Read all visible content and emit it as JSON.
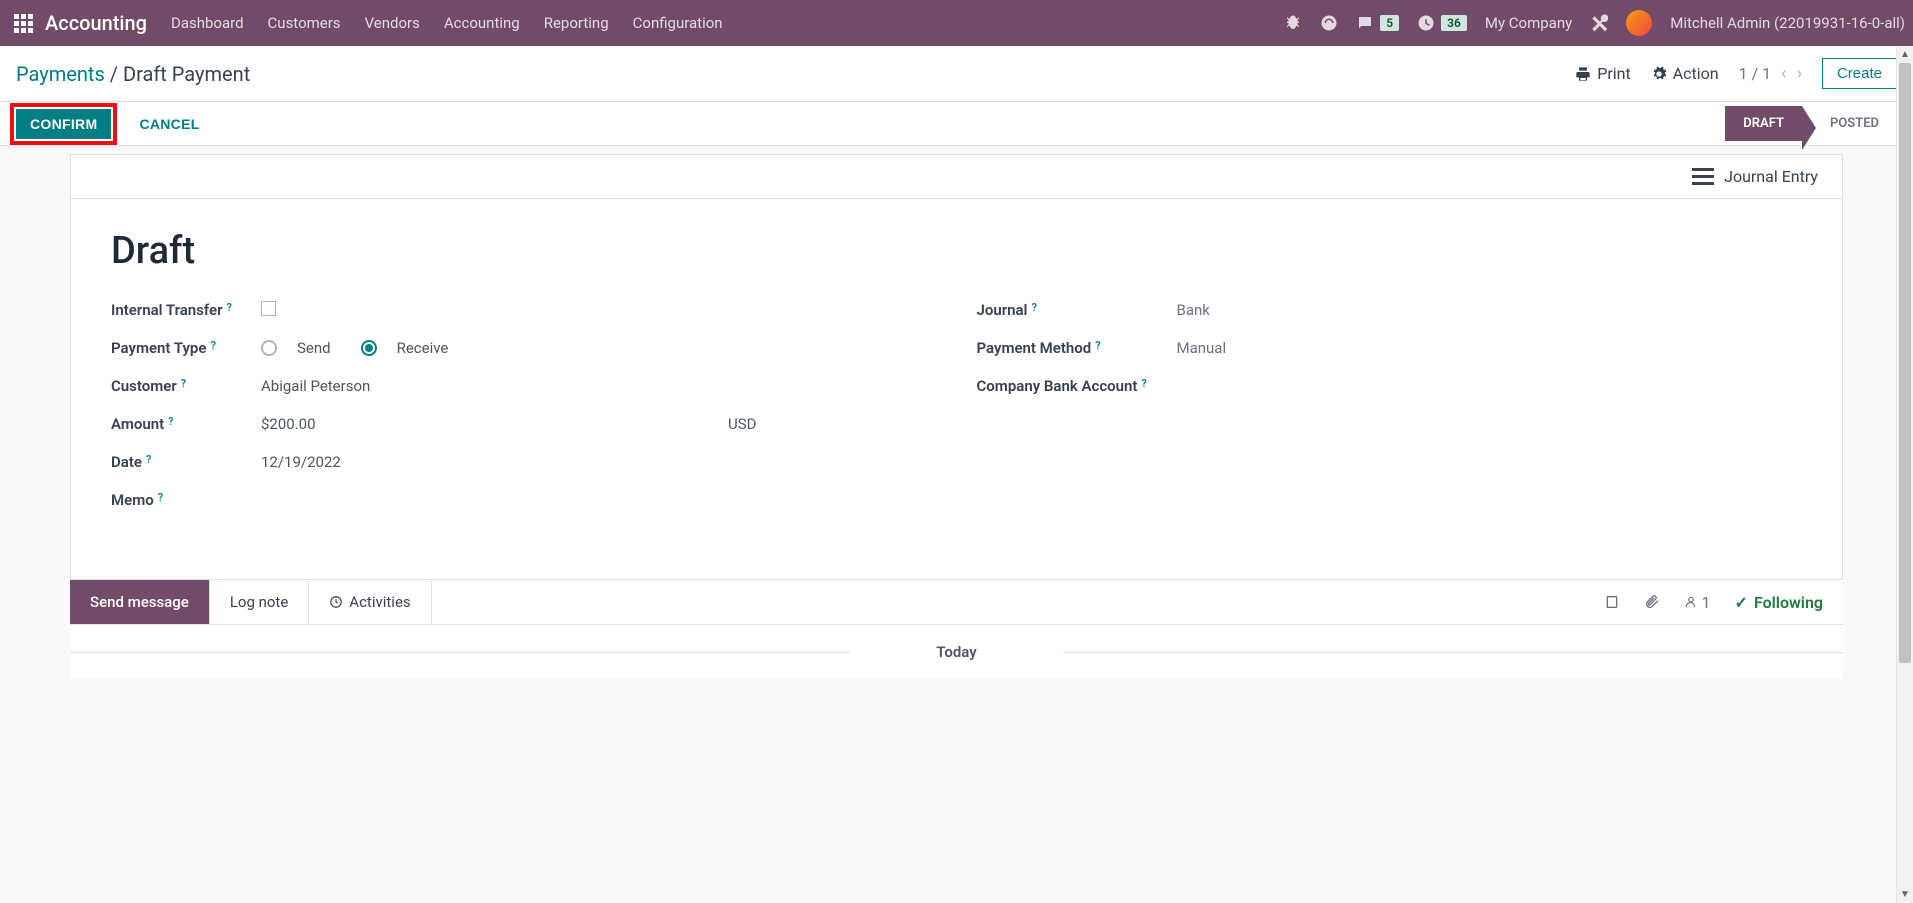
{
  "navbar": {
    "app": "Accounting",
    "menu": [
      "Dashboard",
      "Customers",
      "Vendors",
      "Accounting",
      "Reporting",
      "Configuration"
    ],
    "discuss_count": "5",
    "activities_count": "36",
    "company": "My Company",
    "user": "Mitchell Admin (22019931-16-0-all)"
  },
  "breadcrumb": {
    "parent": "Payments",
    "current": "Draft Payment"
  },
  "actions": {
    "print": "Print",
    "action": "Action",
    "pager": "1 / 1",
    "create": "Create"
  },
  "buttons": {
    "confirm": "CONFIRM",
    "cancel": "CANCEL"
  },
  "stages": {
    "draft": "DRAFT",
    "posted": "POSTED"
  },
  "card": {
    "journal_entry": "Journal Entry",
    "title": "Draft"
  },
  "fields": {
    "internal_transfer": {
      "label": "Internal Transfer",
      "value": false
    },
    "payment_type": {
      "label": "Payment Type",
      "send": "Send",
      "receive": "Receive",
      "selected": "receive"
    },
    "customer": {
      "label": "Customer",
      "value": "Abigail Peterson"
    },
    "amount": {
      "label": "Amount",
      "value": "$200.00",
      "currency": "USD"
    },
    "date": {
      "label": "Date",
      "value": "12/19/2022"
    },
    "memo": {
      "label": "Memo",
      "value": ""
    },
    "journal": {
      "label": "Journal",
      "value": "Bank"
    },
    "payment_method": {
      "label": "Payment Method",
      "value": "Manual"
    },
    "company_bank": {
      "label": "Company Bank Account",
      "value": ""
    }
  },
  "chatter": {
    "send": "Send message",
    "log": "Log note",
    "activities": "Activities",
    "followers": "1",
    "following": "Following",
    "today": "Today"
  }
}
